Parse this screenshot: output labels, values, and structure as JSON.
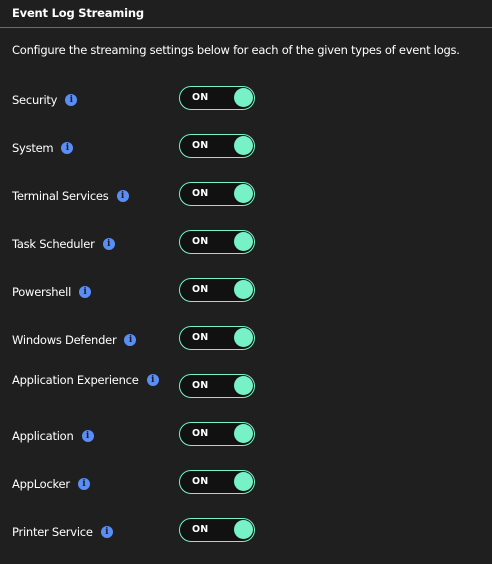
{
  "section": {
    "title": "Event Log Streaming",
    "description": "Configure the streaming settings below for each of the given types of event logs."
  },
  "colors": {
    "background": "#1f1f1f",
    "toggle_accent": "#77f2c7",
    "info_icon": "#5b8ef5",
    "divider": "#6a6a6a"
  },
  "icons": {
    "info": "info-icon"
  },
  "rows": [
    {
      "label": "Security",
      "toggle_state": "ON"
    },
    {
      "label": "System",
      "toggle_state": "ON"
    },
    {
      "label": "Terminal Services",
      "toggle_state": "ON"
    },
    {
      "label": "Task Scheduler",
      "toggle_state": "ON"
    },
    {
      "label": "Powershell",
      "toggle_state": "ON"
    },
    {
      "label": "Windows Defender",
      "toggle_state": "ON"
    },
    {
      "label": "Application Experience",
      "toggle_state": "ON"
    },
    {
      "label": "Application",
      "toggle_state": "ON"
    },
    {
      "label": "AppLocker",
      "toggle_state": "ON"
    },
    {
      "label": "Printer Service",
      "toggle_state": "ON"
    }
  ]
}
